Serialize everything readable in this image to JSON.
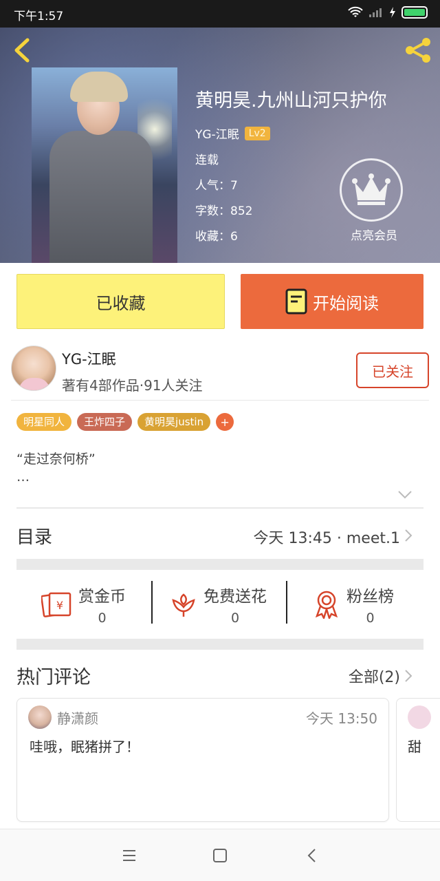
{
  "status_bar": {
    "time": "下午1:57",
    "battery_color": "#3fd16b"
  },
  "header": {
    "back_icon": "chevron-left-icon",
    "share_icon": "share-icon",
    "accent": "#f5d33c"
  },
  "book": {
    "title": "黄明昊.九州山河只护你",
    "author": "YG-江眠",
    "level": "Lv2",
    "status": "连载",
    "popularity": "人气：7",
    "word_count": "字数：852",
    "favorites": "收藏：6",
    "vip_label": "点亮会员"
  },
  "actions": {
    "favorited_label": "已收藏",
    "read_label": "开始阅读",
    "read_color": "#ec6a3d",
    "favorited_color": "#fdf27a"
  },
  "author_card": {
    "name": "YG-江眠",
    "meta": "著有4部作品·91人关注",
    "follow_label": "已关注"
  },
  "tags": [
    {
      "label": "明星同人",
      "color": "#f1b43e"
    },
    {
      "label": "王炸四子",
      "color": "#c96a55"
    },
    {
      "label": "黄明昊justin",
      "color": "#d9a233"
    }
  ],
  "tag_add_label": "+",
  "intro": {
    "text": "“走过奈何桥”",
    "more": "…"
  },
  "toc": {
    "title": "目录",
    "latest": "今天 13:45 · meet.1"
  },
  "rewards": [
    {
      "label": "赏金币",
      "value": "0",
      "icon": "red-envelope-icon"
    },
    {
      "label": "免费送花",
      "value": "0",
      "icon": "flower-icon"
    },
    {
      "label": "粉丝榜",
      "value": "0",
      "icon": "medal-icon"
    }
  ],
  "hot_comments": {
    "title": "热门评论",
    "all_label": "全部(2)",
    "items": [
      {
        "user": "静潇颜",
        "time": "今天 13:50",
        "text": "哇哦，眠猪拼了！"
      },
      {
        "text": "甜"
      }
    ]
  },
  "nav": {
    "menu_icon": "menu-icon",
    "home_icon": "home-square-icon",
    "back_icon": "back-triangle-icon"
  }
}
